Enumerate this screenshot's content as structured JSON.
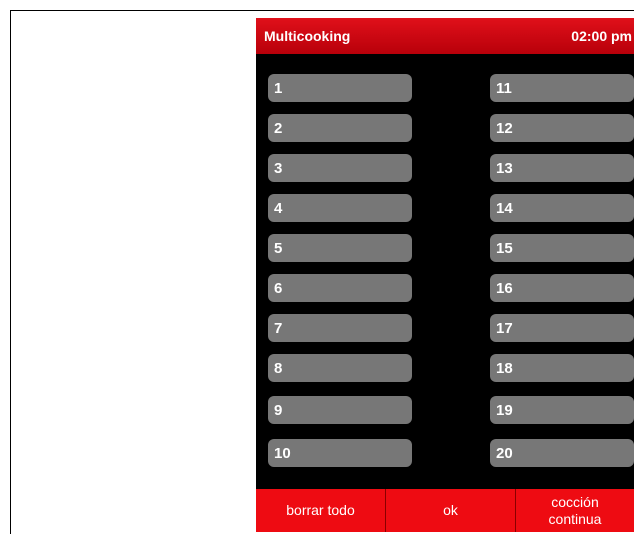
{
  "header": {
    "title": "Multicooking",
    "time": "02:00 pm"
  },
  "slots_left": [
    "1",
    "2",
    "3",
    "4",
    "5",
    "6",
    "7",
    "8",
    "9",
    "10"
  ],
  "slots_right": [
    "11",
    "12",
    "13",
    "14",
    "15",
    "16",
    "17",
    "18",
    "19",
    "20"
  ],
  "footer": {
    "clear_all": "borrar todo",
    "ok": "ok",
    "continuous_line1": "cocción",
    "continuous_line2": "continua"
  },
  "colors": {
    "header": "#d4000d",
    "slot": "#777777",
    "footer": "#ee0b12",
    "screen": "#000000"
  }
}
